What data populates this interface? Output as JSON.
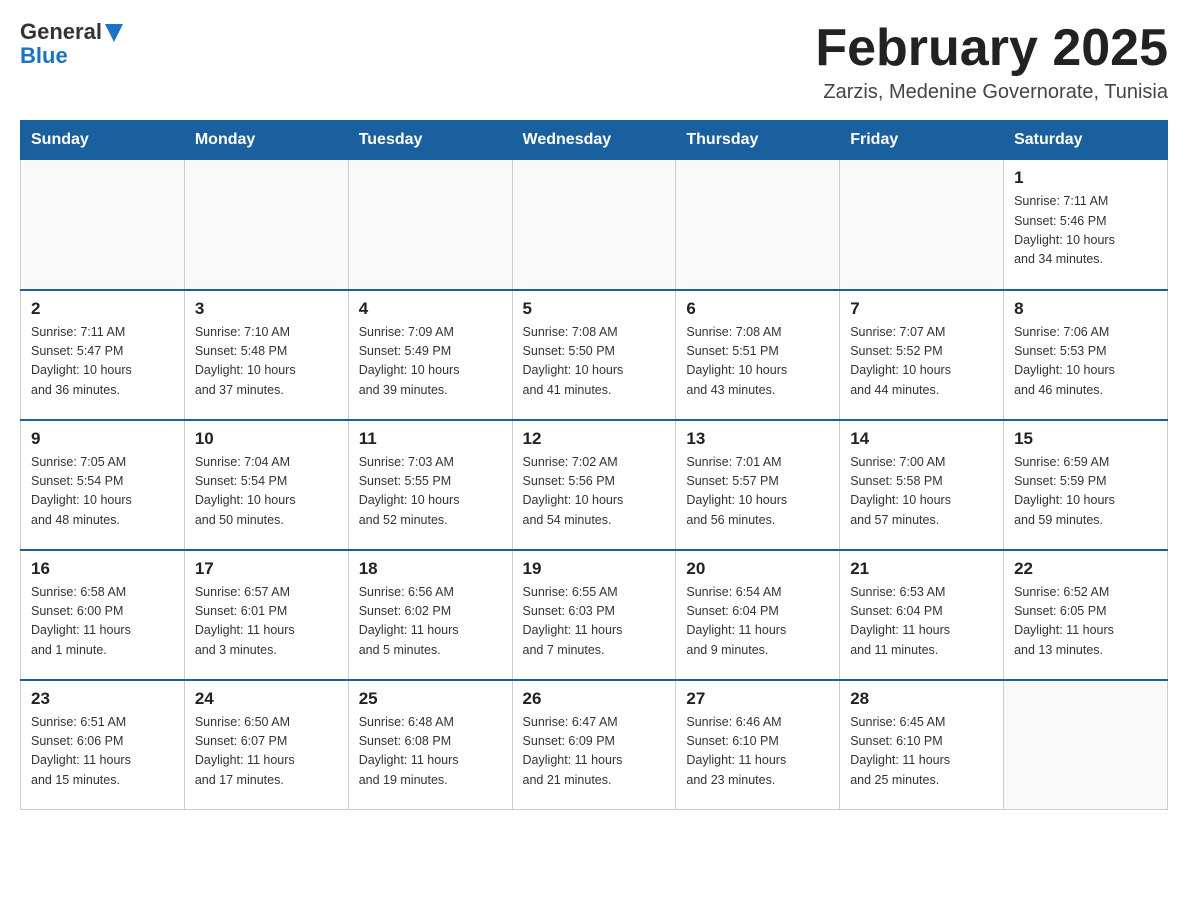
{
  "header": {
    "logo_general": "General",
    "logo_blue": "Blue",
    "month_title": "February 2025",
    "location": "Zarzis, Medenine Governorate, Tunisia"
  },
  "days_of_week": [
    "Sunday",
    "Monday",
    "Tuesday",
    "Wednesday",
    "Thursday",
    "Friday",
    "Saturday"
  ],
  "weeks": [
    [
      {
        "day": "",
        "info": ""
      },
      {
        "day": "",
        "info": ""
      },
      {
        "day": "",
        "info": ""
      },
      {
        "day": "",
        "info": ""
      },
      {
        "day": "",
        "info": ""
      },
      {
        "day": "",
        "info": ""
      },
      {
        "day": "1",
        "info": "Sunrise: 7:11 AM\nSunset: 5:46 PM\nDaylight: 10 hours\nand 34 minutes."
      }
    ],
    [
      {
        "day": "2",
        "info": "Sunrise: 7:11 AM\nSunset: 5:47 PM\nDaylight: 10 hours\nand 36 minutes."
      },
      {
        "day": "3",
        "info": "Sunrise: 7:10 AM\nSunset: 5:48 PM\nDaylight: 10 hours\nand 37 minutes."
      },
      {
        "day": "4",
        "info": "Sunrise: 7:09 AM\nSunset: 5:49 PM\nDaylight: 10 hours\nand 39 minutes."
      },
      {
        "day": "5",
        "info": "Sunrise: 7:08 AM\nSunset: 5:50 PM\nDaylight: 10 hours\nand 41 minutes."
      },
      {
        "day": "6",
        "info": "Sunrise: 7:08 AM\nSunset: 5:51 PM\nDaylight: 10 hours\nand 43 minutes."
      },
      {
        "day": "7",
        "info": "Sunrise: 7:07 AM\nSunset: 5:52 PM\nDaylight: 10 hours\nand 44 minutes."
      },
      {
        "day": "8",
        "info": "Sunrise: 7:06 AM\nSunset: 5:53 PM\nDaylight: 10 hours\nand 46 minutes."
      }
    ],
    [
      {
        "day": "9",
        "info": "Sunrise: 7:05 AM\nSunset: 5:54 PM\nDaylight: 10 hours\nand 48 minutes."
      },
      {
        "day": "10",
        "info": "Sunrise: 7:04 AM\nSunset: 5:54 PM\nDaylight: 10 hours\nand 50 minutes."
      },
      {
        "day": "11",
        "info": "Sunrise: 7:03 AM\nSunset: 5:55 PM\nDaylight: 10 hours\nand 52 minutes."
      },
      {
        "day": "12",
        "info": "Sunrise: 7:02 AM\nSunset: 5:56 PM\nDaylight: 10 hours\nand 54 minutes."
      },
      {
        "day": "13",
        "info": "Sunrise: 7:01 AM\nSunset: 5:57 PM\nDaylight: 10 hours\nand 56 minutes."
      },
      {
        "day": "14",
        "info": "Sunrise: 7:00 AM\nSunset: 5:58 PM\nDaylight: 10 hours\nand 57 minutes."
      },
      {
        "day": "15",
        "info": "Sunrise: 6:59 AM\nSunset: 5:59 PM\nDaylight: 10 hours\nand 59 minutes."
      }
    ],
    [
      {
        "day": "16",
        "info": "Sunrise: 6:58 AM\nSunset: 6:00 PM\nDaylight: 11 hours\nand 1 minute."
      },
      {
        "day": "17",
        "info": "Sunrise: 6:57 AM\nSunset: 6:01 PM\nDaylight: 11 hours\nand 3 minutes."
      },
      {
        "day": "18",
        "info": "Sunrise: 6:56 AM\nSunset: 6:02 PM\nDaylight: 11 hours\nand 5 minutes."
      },
      {
        "day": "19",
        "info": "Sunrise: 6:55 AM\nSunset: 6:03 PM\nDaylight: 11 hours\nand 7 minutes."
      },
      {
        "day": "20",
        "info": "Sunrise: 6:54 AM\nSunset: 6:04 PM\nDaylight: 11 hours\nand 9 minutes."
      },
      {
        "day": "21",
        "info": "Sunrise: 6:53 AM\nSunset: 6:04 PM\nDaylight: 11 hours\nand 11 minutes."
      },
      {
        "day": "22",
        "info": "Sunrise: 6:52 AM\nSunset: 6:05 PM\nDaylight: 11 hours\nand 13 minutes."
      }
    ],
    [
      {
        "day": "23",
        "info": "Sunrise: 6:51 AM\nSunset: 6:06 PM\nDaylight: 11 hours\nand 15 minutes."
      },
      {
        "day": "24",
        "info": "Sunrise: 6:50 AM\nSunset: 6:07 PM\nDaylight: 11 hours\nand 17 minutes."
      },
      {
        "day": "25",
        "info": "Sunrise: 6:48 AM\nSunset: 6:08 PM\nDaylight: 11 hours\nand 19 minutes."
      },
      {
        "day": "26",
        "info": "Sunrise: 6:47 AM\nSunset: 6:09 PM\nDaylight: 11 hours\nand 21 minutes."
      },
      {
        "day": "27",
        "info": "Sunrise: 6:46 AM\nSunset: 6:10 PM\nDaylight: 11 hours\nand 23 minutes."
      },
      {
        "day": "28",
        "info": "Sunrise: 6:45 AM\nSunset: 6:10 PM\nDaylight: 11 hours\nand 25 minutes."
      },
      {
        "day": "",
        "info": ""
      }
    ]
  ]
}
